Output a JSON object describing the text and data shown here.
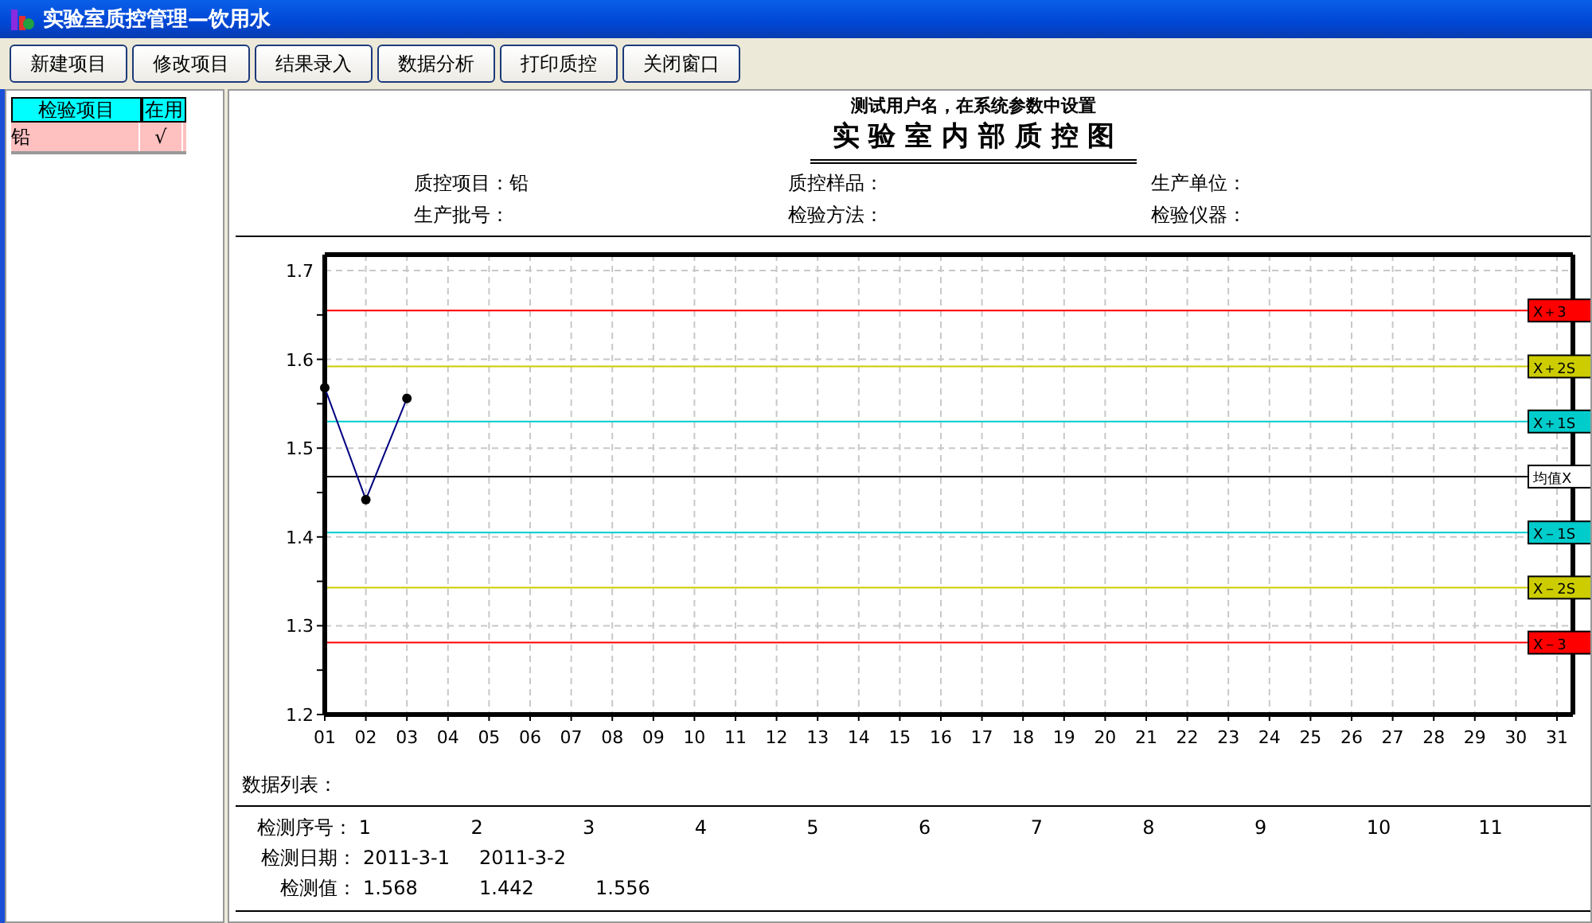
{
  "window": {
    "title": "实验室质控管理—饮用水"
  },
  "toolbar": [
    "新建项目",
    "修改项目",
    "结果录入",
    "数据分析",
    "打印质控",
    "关闭窗口"
  ],
  "item_table": {
    "columns": [
      "检验项目",
      "在用"
    ],
    "rows": [
      {
        "name": "铅",
        "in_use": "√",
        "selected": true
      }
    ]
  },
  "report": {
    "subtitle": "测试用户名，在系统参数中设置",
    "title": "实 验 室 内 部 质 控 图",
    "fields": [
      {
        "label": "质控项目：",
        "value": "铅"
      },
      {
        "label": "质控样品："
      },
      {
        "label": "生产单位："
      },
      {
        "label": "生产批号："
      },
      {
        "label": "检验方法："
      },
      {
        "label": "检验仪器："
      }
    ],
    "chart_data": {
      "type": "line",
      "categories": [
        "01",
        "02",
        "03",
        "04",
        "05",
        "06",
        "07",
        "08",
        "09",
        "10",
        "11",
        "12",
        "13",
        "14",
        "15",
        "16",
        "17",
        "18",
        "19",
        "20",
        "21",
        "22",
        "23",
        "24",
        "25",
        "26",
        "27",
        "28",
        "29",
        "30",
        "31"
      ],
      "grid": true,
      "series": [
        {
          "color": "#000080",
          "marker": "circle",
          "values": [
            1.568,
            1.442,
            1.556,
            null,
            null,
            null,
            null,
            null,
            null,
            null,
            null,
            null,
            null,
            null,
            null,
            null,
            null,
            null,
            null,
            null,
            null,
            null,
            null,
            null,
            null,
            null,
            null,
            null,
            null,
            null,
            null
          ]
        }
      ],
      "ylim": [
        1.2,
        1.7
      ],
      "yticks": [
        1.2,
        1.3,
        1.4,
        1.5,
        1.6,
        1.7
      ],
      "ref_lines": [
        {
          "axis": "y",
          "value": 1.655,
          "label": "X＋3",
          "color": "#ff0000"
        },
        {
          "axis": "y",
          "value": 1.592,
          "label": "X＋2S",
          "color": "#cccc00"
        },
        {
          "axis": "y",
          "value": 1.53,
          "label": "X＋1S",
          "color": "#00cccc"
        },
        {
          "axis": "y",
          "value": 1.468,
          "label": "均值X",
          "color": "#000000"
        },
        {
          "axis": "y",
          "value": 1.405,
          "label": "X－1S",
          "color": "#00cccc"
        },
        {
          "axis": "y",
          "value": 1.343,
          "label": "X－2S",
          "color": "#cccc00"
        },
        {
          "axis": "y",
          "value": 1.281,
          "label": "X－3",
          "color": "#ff0000"
        }
      ]
    },
    "data_list": {
      "title": "数据列表：",
      "rows": [
        {
          "label": "检测序号：",
          "cells": [
            "1",
            "2",
            "3",
            "4",
            "5",
            "6",
            "7",
            "8",
            "9",
            "10",
            "11"
          ]
        },
        {
          "label": "检测日期：",
          "cells": [
            "2011-3-1",
            "2011-3-2"
          ]
        },
        {
          "label": "检测值：",
          "cells": [
            "1.568",
            "1.442",
            "1.556"
          ]
        }
      ]
    }
  }
}
